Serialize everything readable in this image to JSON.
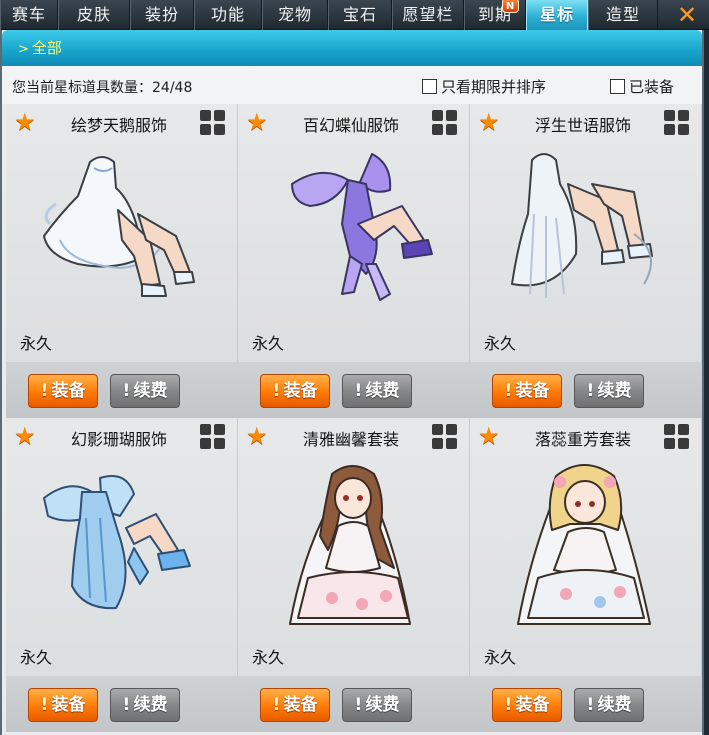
{
  "tabs": [
    {
      "label": "赛车",
      "active": false
    },
    {
      "label": "皮肤",
      "active": false
    },
    {
      "label": "装扮",
      "active": false
    },
    {
      "label": "功能",
      "active": false
    },
    {
      "label": "宠物",
      "active": false
    },
    {
      "label": "宝石",
      "active": false
    },
    {
      "label": "愿望栏",
      "active": false
    },
    {
      "label": "到期",
      "active": false,
      "badge": "N"
    },
    {
      "label": "星标",
      "active": true
    },
    {
      "label": "造型",
      "active": false
    }
  ],
  "close_label": "✕",
  "category": {
    "label": "全部"
  },
  "toolbar": {
    "count_label": "您当前星标道具数量：24/48",
    "filter_expiring_label": "只看期限并排序",
    "filter_equipped_label": "已装备"
  },
  "items": [
    {
      "name": "绘梦天鹅服饰",
      "duration": "永久",
      "equip_label": "装备",
      "renew_label": "续费",
      "image": "swan-dress-icon"
    },
    {
      "name": "百幻蝶仙服饰",
      "duration": "永久",
      "equip_label": "装备",
      "renew_label": "续费",
      "image": "butterfly-fairy-outfit-icon"
    },
    {
      "name": "浮生世语服饰",
      "duration": "永久",
      "equip_label": "装备",
      "renew_label": "续费",
      "image": "veil-gown-icon"
    },
    {
      "name": "幻影珊瑚服饰",
      "duration": "永久",
      "equip_label": "装备",
      "renew_label": "续费",
      "image": "coral-dress-icon"
    },
    {
      "name": "清雅幽馨套装",
      "duration": "永久",
      "equip_label": "装备",
      "renew_label": "续费",
      "image": "bride-brunette-icon"
    },
    {
      "name": "落蕊重芳套装",
      "duration": "永久",
      "equip_label": "装备",
      "renew_label": "续费",
      "image": "bride-blonde-icon"
    }
  ],
  "colors": {
    "accent": "#1aa8cf",
    "star": "#ff8a00",
    "equip": "#ff7a06",
    "renew": "#848586"
  }
}
